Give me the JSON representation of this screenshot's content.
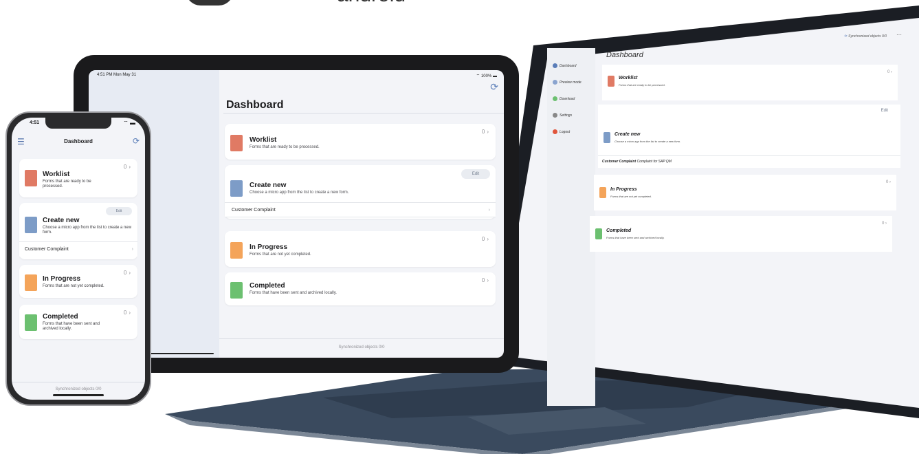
{
  "colors": {
    "accent": "#5a7db8",
    "worklist": "#e07a64",
    "create": "#7d9cc7",
    "in_progress": "#f4a45a",
    "completed": "#6cc070",
    "background": "#f3f4f8"
  },
  "logos": {
    "android_word": "android"
  },
  "ipad": {
    "status_time": "4:51 PM  Mon May 31",
    "status_battery": "100%",
    "title": "Dashboard",
    "worklist": {
      "title": "Worklist",
      "subtitle": "Forms that are ready to be processed.",
      "count": "0"
    },
    "create_new": {
      "title": "Create new",
      "subtitle": "Choose a micro app from the list to create a new form.",
      "edit_label": "Edit",
      "row_label": "Customer Complaint"
    },
    "in_progress": {
      "title": "In Progress",
      "subtitle": "Forms that are not yet completed.",
      "count": "0"
    },
    "completed": {
      "title": "Completed",
      "subtitle": "Forms that have been sent and archived locally.",
      "count": "0"
    },
    "sync_text": "Synchronized objects  0/0"
  },
  "iphone": {
    "status_time": "4:51",
    "title": "Dashboard",
    "worklist": {
      "title": "Worklist",
      "subtitle": "Forms that are ready to be processed.",
      "count": "0"
    },
    "create_new": {
      "title": "Create new",
      "subtitle": "Choose a micro app from the list to create a new form.",
      "edit_label": "Edit",
      "row_label": "Customer Complaint"
    },
    "in_progress": {
      "title": "In Progress",
      "subtitle": "Forms that are not yet completed.",
      "count": "0"
    },
    "completed": {
      "title": "Completed",
      "subtitle": "Forms that have been sent and archived locally.",
      "count": "0"
    },
    "sync_text": "Synchronized objects  0/0"
  },
  "laptop": {
    "title": "Dashboard",
    "sync_text": "Synchronized objects 0/0",
    "sidebar": [
      {
        "label": "Dashboard",
        "icon": "dashboard-icon"
      },
      {
        "label": "Preview mode",
        "icon": "preview-icon"
      },
      {
        "label": "Download",
        "icon": "download-icon"
      },
      {
        "label": "Settings",
        "icon": "settings-icon"
      },
      {
        "label": "Logout",
        "icon": "logout-icon"
      }
    ],
    "worklist": {
      "title": "Worklist",
      "subtitle": "Forms that are ready to be processed.",
      "count": "0"
    },
    "create_new": {
      "title": "Create new",
      "subtitle": "Choose a micro app from the list to create a new form.",
      "edit_label": "Edit",
      "row_bold": "Customer Complaint",
      "row_rest": "Complaint for SAP QM"
    },
    "in_progress": {
      "title": "In Progress",
      "subtitle": "Forms that are not yet completed.",
      "count": "0"
    },
    "completed": {
      "title": "Completed",
      "subtitle": "Forms that have been sent and archived locally.",
      "count": "0"
    }
  }
}
